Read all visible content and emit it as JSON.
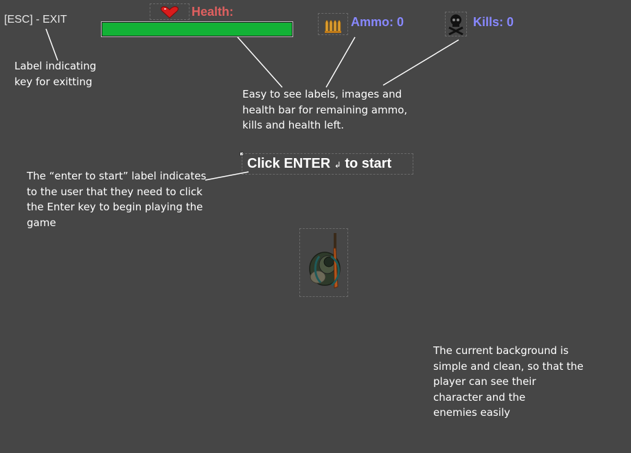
{
  "hud": {
    "exit_label": "[ESC] - EXIT",
    "health_label": "Health:",
    "health_fraction": 1.0,
    "ammo_label": "Ammo: 0",
    "kills_label": "Kills: 0",
    "icons": {
      "health": "heart-icon",
      "ammo": "bullets-icon",
      "kills": "skull-crossbones-icon"
    }
  },
  "start_prompt": {
    "before": "Click ENTER",
    "glyph": "↲",
    "after": "to start"
  },
  "annotations": {
    "exit": [
      "Label indicating",
      "key for exitting"
    ],
    "hud": [
      "Easy to see labels, images and",
      "health bar for remaining ammo,",
      "kills and health left."
    ],
    "enter": [
      "The “enter to start” label indicates",
      "to the user that they need to click",
      "the Enter key to begin playing the",
      "game"
    ],
    "background": [
      "The current background is",
      "simple and clean, so that the",
      "player can see their",
      "character and the",
      "enemies easily"
    ]
  },
  "colors": {
    "background": "#464646",
    "health_text": "#e06060",
    "health_fill": "#13b236",
    "ammo_text": "#8888ff",
    "kills_text": "#8888ff",
    "annotation_text": "#ffffff"
  }
}
